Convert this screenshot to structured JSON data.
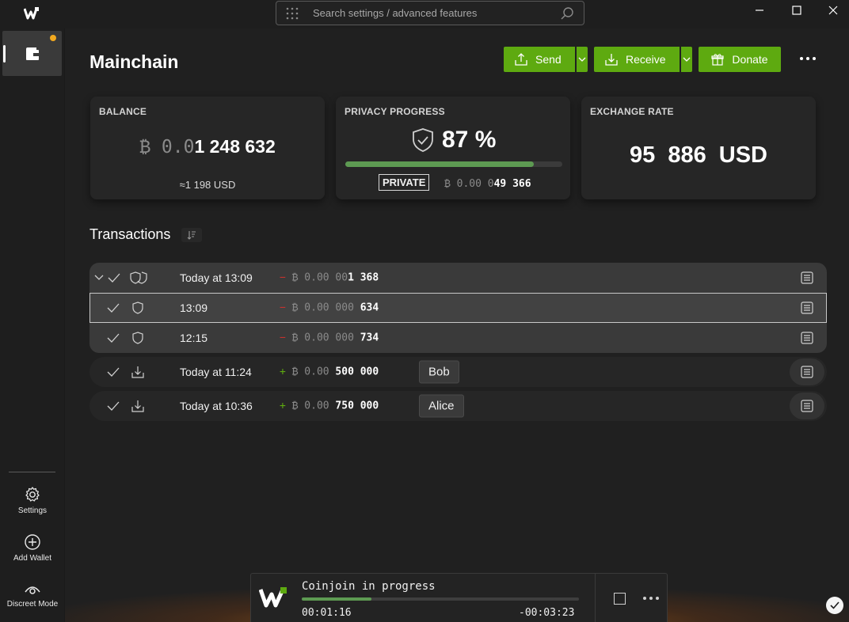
{
  "search": {
    "placeholder": "Search settings / advanced features"
  },
  "sidebar": {
    "wallet_icon": "wallet-icon",
    "items": [
      {
        "label": "Settings",
        "icon": "gear-icon"
      },
      {
        "label": "Add Wallet",
        "icon": "plus-circle-icon"
      },
      {
        "label": "Discreet Mode",
        "icon": "eye-icon"
      }
    ]
  },
  "header": {
    "title": "Mainchain",
    "send_label": "Send",
    "receive_label": "Receive",
    "donate_label": "Donate"
  },
  "balance": {
    "title": "BALANCE",
    "amount_dim": "₿ 0.0",
    "amount_bold": "1 248 632",
    "usd": "≈1 198 USD"
  },
  "privacy": {
    "title": "PRIVACY PROGRESS",
    "percent_text": "87 %",
    "percent": 87,
    "badge": "PRIVATE",
    "amount_dim": "₿ 0.00 0",
    "amount_bold": "49 366"
  },
  "exchange": {
    "title": "EXCHANGE RATE",
    "rate": "95 886 USD"
  },
  "transactions": {
    "title": "Transactions",
    "rows": [
      {
        "date": "Today at 13:09",
        "sign": "−",
        "amount_dim": "₿ 0.00 00",
        "amount_bold": "1 368",
        "label": "",
        "icon": "coinjoin-shield-icon"
      },
      {
        "date": "13:09",
        "sign": "−",
        "amount_dim": "₿ 0.00 000",
        "amount_bold": "634",
        "label": "",
        "icon": "shield-icon"
      },
      {
        "date": "12:15",
        "sign": "−",
        "amount_dim": "₿ 0.00 000",
        "amount_bold": "734",
        "label": "",
        "icon": "shield-icon"
      },
      {
        "date": "Today at 11:24",
        "sign": "+",
        "amount_dim": "₿ 0.00",
        "amount_bold": "500 000",
        "label": "Bob",
        "icon": "download-icon"
      },
      {
        "date": "Today at 10:36",
        "sign": "+",
        "amount_dim": "₿ 0.00",
        "amount_bold": "750 000",
        "label": "Alice",
        "icon": "download-icon"
      }
    ]
  },
  "coinjoin": {
    "title": "Coinjoin in progress",
    "elapsed": "00:01:16",
    "remaining": "-00:03:23",
    "progress": 0.25
  },
  "colors": {
    "accent_green": "#5eaa10",
    "progress_green": "#5d9a52",
    "negative_red": "#c8322f",
    "notification_orange": "#f2a91f"
  }
}
